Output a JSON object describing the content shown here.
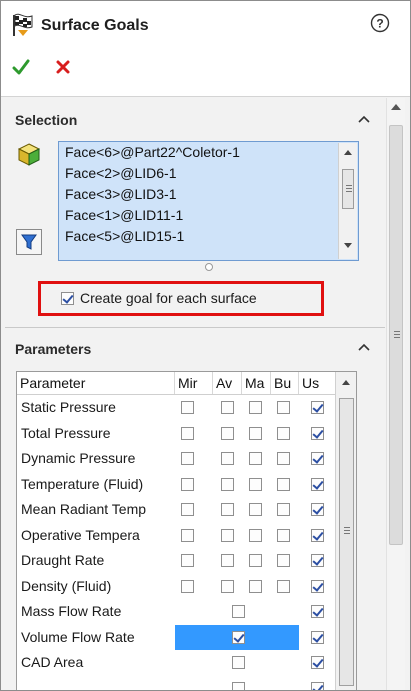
{
  "header": {
    "title": "Surface Goals",
    "title_icon": "checkered-flag-icon",
    "help_icon": "help-icon"
  },
  "actions": {
    "ok_icon": "green-check-icon",
    "cancel_icon": "red-x-icon"
  },
  "selection": {
    "heading": "Selection",
    "items": [
      "Face<6>@Part22^Coletor-1",
      "Face<2>@LID6-1",
      "Face<3>@LID3-1",
      "Face<1>@LID11-1",
      "Face<5>@LID15-1"
    ],
    "checkbox_label": "Create goal for each surface",
    "checkbox_checked": true
  },
  "parameters": {
    "heading": "Parameters",
    "columns": [
      "Parameter",
      "Mir",
      "Av",
      "Ma",
      "Bu",
      "Us"
    ],
    "rows": [
      {
        "name": "Static Pressure",
        "min": false,
        "av": false,
        "max": false,
        "bulk": false,
        "use": true
      },
      {
        "name": "Total Pressure",
        "min": false,
        "av": false,
        "max": false,
        "bulk": false,
        "use": true
      },
      {
        "name": "Dynamic Pressure",
        "min": false,
        "av": false,
        "max": false,
        "bulk": false,
        "use": true
      },
      {
        "name": "Temperature (Fluid)",
        "min": false,
        "av": false,
        "max": false,
        "bulk": false,
        "use": true
      },
      {
        "name": "Mean Radiant Temp",
        "min": false,
        "av": false,
        "max": false,
        "bulk": false,
        "use": true
      },
      {
        "name": "Operative Tempera",
        "min": false,
        "av": false,
        "max": false,
        "bulk": false,
        "use": true
      },
      {
        "name": "Draught Rate",
        "min": false,
        "av": false,
        "max": false,
        "bulk": false,
        "use": true
      },
      {
        "name": "Density (Fluid)",
        "min": false,
        "av": false,
        "max": false,
        "bulk": false,
        "use": true
      },
      {
        "name": "Mass Flow Rate",
        "single": false,
        "use": true
      },
      {
        "name": "Volume Flow Rate",
        "single": true,
        "use": true,
        "highlight": true
      },
      {
        "name": "CAD Area",
        "single": false,
        "use": true
      },
      {
        "name": "",
        "single": false,
        "use": true
      }
    ]
  },
  "colors": {
    "selection_bg": "#cfe3f9",
    "row_highlight": "#3399ff",
    "annotation_box": "#e01010"
  }
}
